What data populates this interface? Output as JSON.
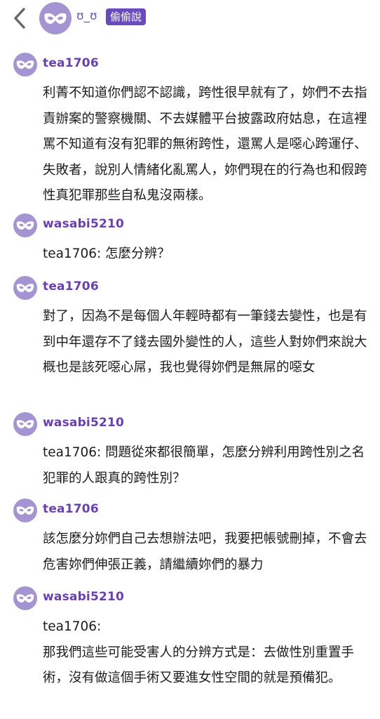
{
  "header": {
    "back_icon": "chevron-left-icon",
    "avatar_icon": "anonymous-mask-icon",
    "poster_name": "ʊ_ʊ",
    "poster_badge": "偷偷說"
  },
  "comments": [
    {
      "author": "tea1706",
      "avatar_icon": "anonymous-mask-icon",
      "text": "利菁不知道你們認不認識，跨性很早就有了，妳們不去指責辦案的警察機關、不去媒體平台披露政府姑息，在這裡罵不知道有沒有犯罪的無術跨性，還罵人是噁心跨運仔、失敗者，說別人情緒化亂罵人，妳們現在的行為也和假跨性真犯罪那些自私鬼沒兩樣。"
    },
    {
      "author": "wasabi5210",
      "avatar_icon": "anonymous-mask-icon",
      "text": "tea1706: 怎麼分辨？"
    },
    {
      "author": "tea1706",
      "avatar_icon": "anonymous-mask-icon",
      "text": "對了，因為不是每個人年輕時都有一筆錢去變性，也是有到中年還存不了錢去國外變性的人，這些人對妳們來說大概也是該死噁心屌，我也覺得妳們是無屌的噁女"
    },
    {
      "author": "wasabi5210",
      "avatar_icon": "anonymous-mask-icon",
      "text": "tea1706: 問題從來都很簡單，怎麼分辨利用跨性別之名犯罪的人跟真的跨性別？"
    },
    {
      "author": "tea1706",
      "avatar_icon": "anonymous-mask-icon",
      "text": "該怎麼分妳們自己去想辦法吧，我要把帳號刪掉，不會去危害妳們伸張正義，請繼續妳們的暴力"
    },
    {
      "author": "wasabi5210",
      "avatar_icon": "anonymous-mask-icon",
      "text": "tea1706:\n那我們這些可能受害人的分辨方式是：去做性別重置手術，沒有做這個手術又要進女性空間的就是預備犯。"
    }
  ],
  "colors": {
    "avatar_bg": "#a594d2",
    "username": "#6a3fb5",
    "badge_bg": "#6a4bbd"
  }
}
